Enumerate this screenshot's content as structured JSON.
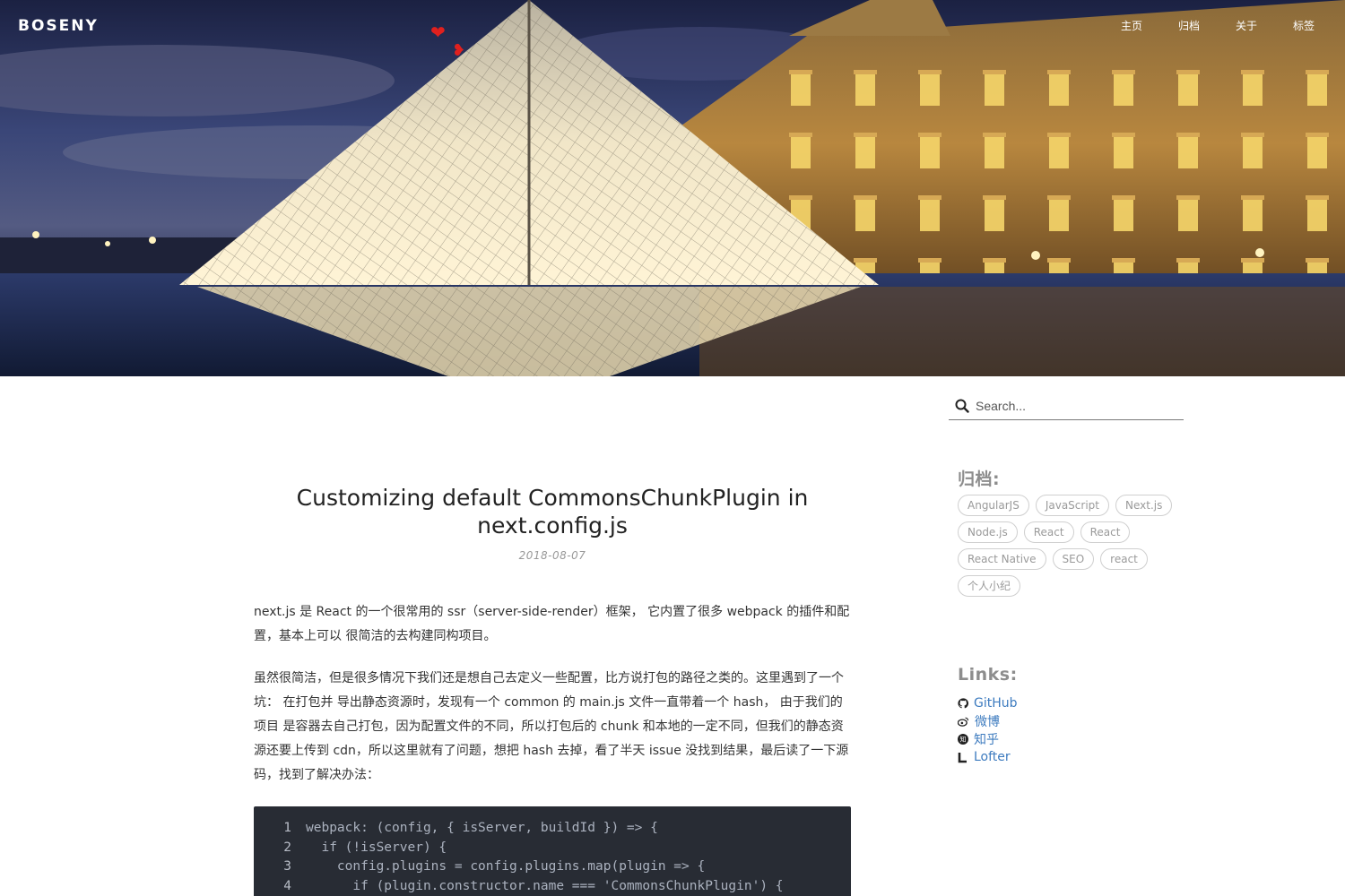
{
  "header": {
    "brand": "BOSENY",
    "nav": [
      "主页",
      "归档",
      "关于",
      "标签"
    ],
    "hearts": [
      "❤",
      "❥"
    ]
  },
  "search": {
    "placeholder": "Search..."
  },
  "sidebar": {
    "archive_title": "归档:",
    "tags": [
      "AngularJS",
      "JavaScript",
      "Next.js",
      "Node.js",
      "React",
      "React",
      "React Native",
      "SEO",
      "react",
      "个人小纪"
    ],
    "links_title": "Links:",
    "links": [
      {
        "icon": "github-icon",
        "label": "GitHub"
      },
      {
        "icon": "weibo-icon",
        "label": "微博"
      },
      {
        "icon": "zhihu-icon",
        "label": "知乎"
      },
      {
        "icon": "lofter-icon",
        "label": "Lofter"
      }
    ]
  },
  "post": {
    "title": "Customizing default CommonsChunkPlugin in next.config.js",
    "date": "2018-08-07",
    "paragraphs": [
      "next.js 是 React 的一个很常用的 ssr（server-side-render）框架， 它内置了很多 webpack 的插件和配置，基本上可以 很简洁的去构建同构项目。",
      "虽然很简洁，但是很多情况下我们还是想自己去定义一些配置，比方说打包的路径之类的。这里遇到了一个坑： 在打包并 导出静态资源时，发现有一个 common 的 main.js 文件一直带着一个 hash， 由于我们的项目 是容器去自己打包，因为配置文件的不同，所以打包后的 chunk 和本地的一定不同，但我们的静态资源还要上传到 cdn，所以这里就有了问题，想把 hash 去掉，看了半天 issue 没找到结果，最后读了一下源码，找到了解决办法："
    ],
    "code": {
      "line_numbers": [
        "1",
        "2",
        "3",
        "4"
      ],
      "lines": [
        "webpack: (config, { isServer, buildId }) => {",
        "  if (!isServer) {",
        "    config.plugins = config.plugins.map(plugin => {",
        "      if (plugin.constructor.name === 'CommonsChunkPlugin') {"
      ]
    }
  },
  "colors": {
    "accent_link": "#3d7bbf",
    "code_bg": "#282c34",
    "heart": "#e0201e"
  }
}
